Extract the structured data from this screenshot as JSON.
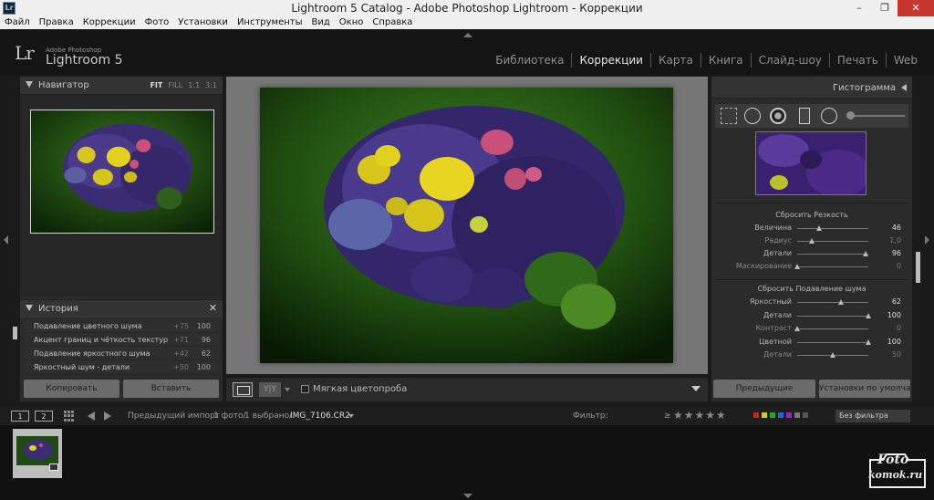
{
  "window": {
    "title": "Lightroom 5 Catalog - Adobe Photoshop Lightroom - Коррекции",
    "app_icon": "Lr",
    "controls": [
      "–",
      "❐",
      "✕"
    ]
  },
  "menu": [
    "Файл",
    "Правка",
    "Коррекции",
    "Фото",
    "Установки",
    "Инструменты",
    "Вид",
    "Окно",
    "Справка"
  ],
  "identity": {
    "logo": "Lr",
    "vendor": "Adobe Photoshop",
    "product": "Lightroom 5"
  },
  "modules": [
    "Библиотека",
    "Коррекции",
    "Карта",
    "Книга",
    "Слайд-шоу",
    "Печать",
    "Web"
  ],
  "active_module": "Коррекции",
  "navigator": {
    "title": "Навигатор",
    "zoom": [
      "FIT",
      "FILL",
      "1:1",
      "3:1"
    ],
    "selected_zoom": "FIT"
  },
  "history": {
    "title": "История",
    "close": "✕",
    "items": [
      {
        "name": "Подавление цветного шума",
        "delta": "+75",
        "value": "100"
      },
      {
        "name": "Акцент границ и чёткость текстур",
        "delta": "+71",
        "value": "96"
      },
      {
        "name": "Подавление яркостного шума",
        "delta": "+42",
        "value": "62"
      },
      {
        "name": "Яркостный шум - детали",
        "delta": "+50",
        "value": "100"
      }
    ]
  },
  "left_buttons": {
    "copy": "Копировать",
    "paste": "Вставить"
  },
  "toolbar": {
    "yy": "Y|Y",
    "soft_proof": "Мягкая цветопроба"
  },
  "right_panel": {
    "histogram_title": "Гистограмма",
    "sharpening": {
      "title": "Сбросить Резкость",
      "sliders": [
        {
          "label": "Величина",
          "value": "46",
          "fraction": 0.31,
          "dim": false
        },
        {
          "label": "Радиус",
          "value": "1,0",
          "fraction": 0.2,
          "dim": true
        },
        {
          "label": "Детали",
          "value": "96",
          "fraction": 0.96,
          "dim": false
        },
        {
          "label": "Маскирование",
          "value": "0",
          "fraction": 0.0,
          "dim": true
        }
      ]
    },
    "noise": {
      "title": "Сбросить Подавление шума",
      "sliders": [
        {
          "label": "Яркостный",
          "value": "62",
          "fraction": 0.62,
          "dim": false
        },
        {
          "label": "Детали",
          "value": "100",
          "fraction": 1.0,
          "dim": false
        },
        {
          "label": "Контраст",
          "value": "0",
          "fraction": 0.0,
          "dim": true
        },
        {
          "label": "Цветной",
          "value": "100",
          "fraction": 1.0,
          "dim": false
        },
        {
          "label": "Детали",
          "value": "50",
          "fraction": 0.5,
          "dim": true
        }
      ]
    },
    "buttons": {
      "previous": "Предыдущие",
      "defaults": "Установки по умолчанию..."
    }
  },
  "filmstrip": {
    "view1": "1",
    "view2": "2",
    "source": "Предыдущий импорт",
    "count": "1 фото/",
    "selected": "1 выбрано/",
    "filename": "IMG_7106.CR2",
    "filter_label": "Фильтр:",
    "rating_op": "≥",
    "stars": "★★★★★",
    "filter_value": "Без фильтра",
    "label_colors": [
      "#c22",
      "#cc2",
      "#2a2",
      "#26c",
      "#92c",
      "#777",
      "#555"
    ]
  },
  "watermark": {
    "line1": "Foto",
    "line2": "komok.ru"
  }
}
